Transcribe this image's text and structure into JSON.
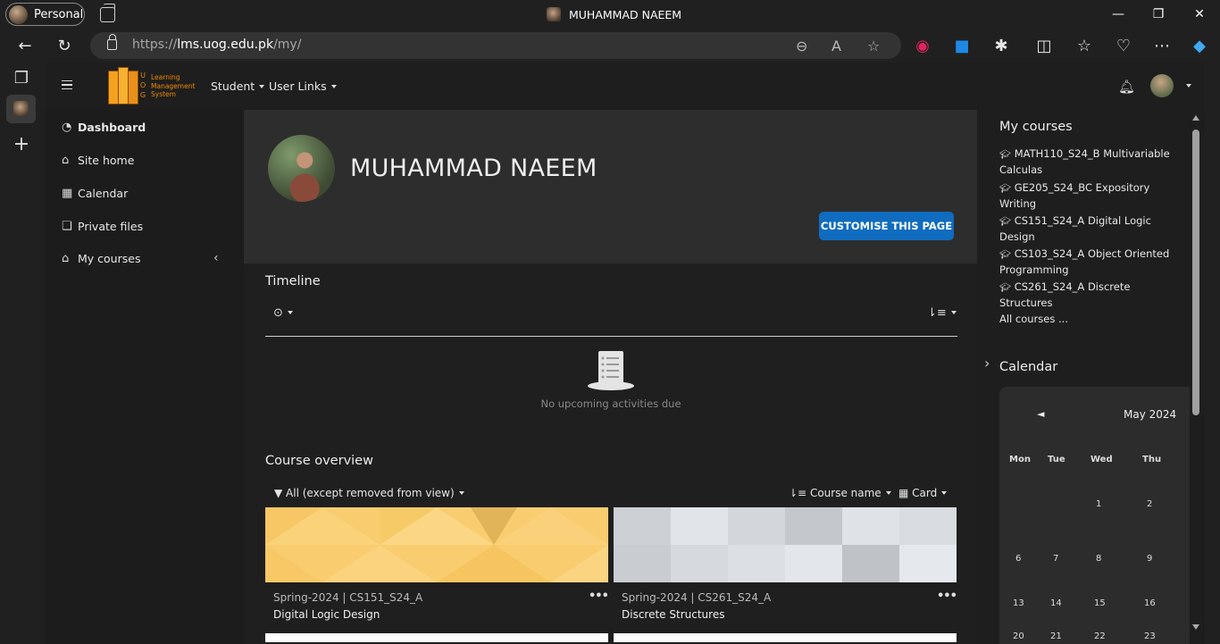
{
  "browser": {
    "profile_label": "Personal",
    "window_title": "MUHAMMAD NAEEM",
    "url_prefix": "https://",
    "url_host": "lms.uog.edu.pk",
    "url_path": "/my/",
    "window_controls": {
      "minimize": "—",
      "restore": "❐",
      "close": "✕"
    }
  },
  "lms": {
    "logo": {
      "letters": [
        "U",
        "O",
        "G"
      ],
      "lines": [
        "Learning",
        "Management",
        "System"
      ]
    },
    "menus": [
      "Student",
      "User Links"
    ]
  },
  "drawer": {
    "items": [
      {
        "label": "Dashboard",
        "icon": "dashboard-icon"
      },
      {
        "label": "Site home",
        "icon": "home-icon"
      },
      {
        "label": "Calendar",
        "icon": "calendar-icon"
      },
      {
        "label": "Private files",
        "icon": "file-icon"
      },
      {
        "label": "My courses",
        "icon": "graduation-cap-icon"
      }
    ]
  },
  "header": {
    "name": "MUHAMMAD NAEEM",
    "customise_label": "CUSTOMISE THIS PAGE"
  },
  "timeline": {
    "title": "Timeline",
    "empty_text": "No upcoming activities due"
  },
  "course_overview": {
    "title": "Course overview",
    "filter_label": "All (except removed from view)",
    "sort_label": "Course name",
    "view_label": "Card",
    "cards": [
      {
        "meta": "Spring-2024 | CS151_S24_A",
        "name": "Digital Logic Design",
        "more": "•••"
      },
      {
        "meta": "Spring-2024 | CS261_S24_A",
        "name": "Discrete Structures",
        "more": "•••"
      }
    ]
  },
  "my_courses": {
    "title": "My courses",
    "items": [
      "MATH110_S24_B Multivariable Calculas",
      "GE205_S24_BC Expository Writing",
      "CS151_S24_A Digital Logic Design",
      "CS103_S24_A Object Oriented Programming",
      "CS261_S24_A Discrete Structures"
    ],
    "all_label": "All courses ..."
  },
  "calendar": {
    "title": "Calendar",
    "prev": "◄",
    "month": "May 2024",
    "days_of_week": [
      "Mon",
      "Tue",
      "Wed",
      "Thu"
    ],
    "rows": [
      [
        "",
        "",
        "1",
        "2"
      ],
      [
        "6",
        "7",
        "8",
        "9"
      ],
      [
        "13",
        "14",
        "15",
        "16"
      ],
      [
        "20",
        "21",
        "22",
        "23"
      ]
    ]
  },
  "colors": {
    "accent_button": "#0f6cbf",
    "card1_pattern": "#f9cd6f",
    "card2_pattern": "#d5d8dc"
  }
}
